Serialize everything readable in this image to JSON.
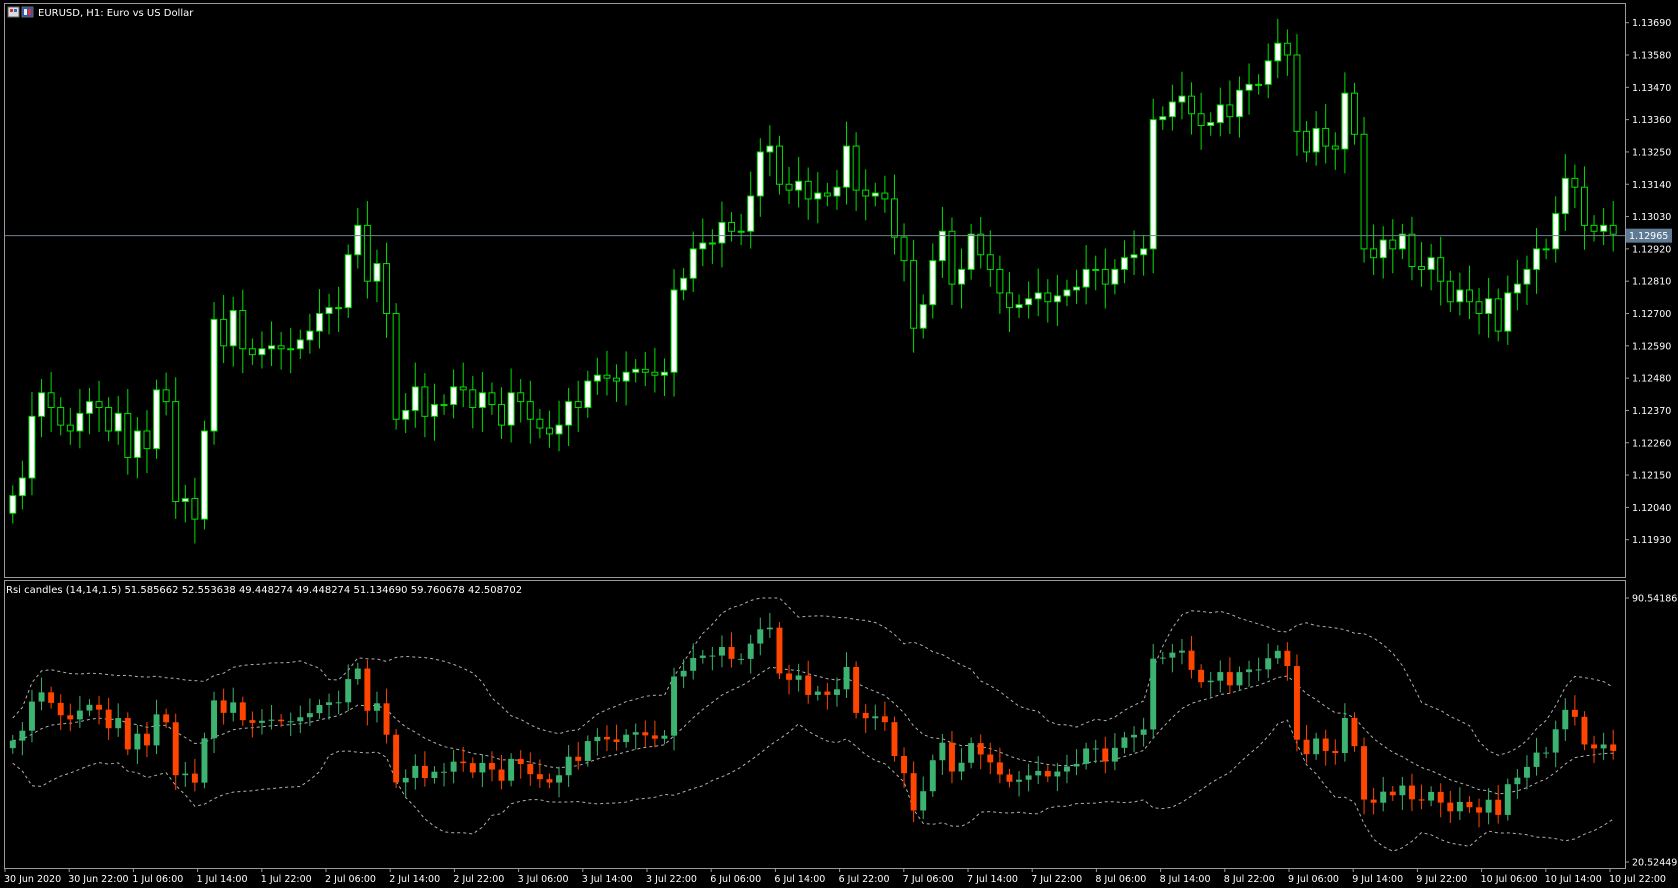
{
  "window": {
    "title": "EURUSD, H1:  Euro vs US Dollar"
  },
  "colors": {
    "background": "#000000",
    "bull_candle": "#ffffff",
    "bear_candle": "#000000",
    "candle_outline": "#00e000",
    "rsi_up": "#3cb371",
    "rsi_down": "#ff4500",
    "band": "#b0b0b0",
    "price_line": "#708090",
    "price_tag": "#5f7a94"
  },
  "chart_data": [
    {
      "type": "candlestick",
      "title": "EURUSD, H1:  Euro vs US Dollar",
      "ylim": [
        1.1182,
        1.1374
      ],
      "y_ticks": [
        "1.13690",
        "1.13580",
        "1.13470",
        "1.13360",
        "1.13250",
        "1.13140",
        "1.13030",
        "1.12920",
        "1.12810",
        "1.12700",
        "1.12590",
        "1.12480",
        "1.12370",
        "1.12260",
        "1.12150",
        "1.12040",
        "1.11930"
      ],
      "current_price": "1.12965",
      "closes": [
        1.1208,
        1.1214,
        1.1235,
        1.1243,
        1.1238,
        1.1232,
        1.123,
        1.1236,
        1.124,
        1.1238,
        1.123,
        1.1236,
        1.1221,
        1.123,
        1.1224,
        1.1244,
        1.124,
        1.1206,
        1.1207,
        1.12,
        1.123,
        1.1268,
        1.1259,
        1.1271,
        1.1258,
        1.1256,
        1.1258,
        1.1259,
        1.1258,
        1.1258,
        1.1261,
        1.1264,
        1.127,
        1.1272,
        1.1272,
        1.129,
        1.13,
        1.1281,
        1.1287,
        1.127,
        1.1234,
        1.1237,
        1.1245,
        1.1235,
        1.1239,
        1.1239,
        1.1245,
        1.1244,
        1.1238,
        1.1243,
        1.1239,
        1.1232,
        1.1243,
        1.124,
        1.1234,
        1.1231,
        1.1229,
        1.1232,
        1.124,
        1.1238,
        1.1247,
        1.1249,
        1.1248,
        1.1247,
        1.125,
        1.1251,
        1.125,
        1.1249,
        1.125,
        1.1278,
        1.1282,
        1.1292,
        1.1294,
        1.1294,
        1.1301,
        1.1298,
        1.1298,
        1.131,
        1.1325,
        1.1327,
        1.1314,
        1.1312,
        1.1315,
        1.1309,
        1.1311,
        1.131,
        1.1313,
        1.1327,
        1.1312,
        1.131,
        1.1311,
        1.1309,
        1.1296,
        1.1288,
        1.1265,
        1.1273,
        1.1288,
        1.1298,
        1.128,
        1.1285,
        1.1297,
        1.129,
        1.1285,
        1.1277,
        1.1272,
        1.1273,
        1.1275,
        1.1277,
        1.1274,
        1.1276,
        1.1278,
        1.1279,
        1.1285,
        1.1285,
        1.128,
        1.1285,
        1.1289,
        1.129,
        1.1292,
        1.1336,
        1.1337,
        1.1342,
        1.1344,
        1.1338,
        1.1334,
        1.1335,
        1.1341,
        1.1337,
        1.1346,
        1.1348,
        1.1348,
        1.1356,
        1.1362,
        1.1358,
        1.1332,
        1.1325,
        1.1333,
        1.1327,
        1.1326,
        1.1345,
        1.1331,
        1.1292,
        1.1289,
        1.1295,
        1.1292,
        1.1297,
        1.1286,
        1.1285,
        1.1289,
        1.1281,
        1.1274,
        1.1278,
        1.1274,
        1.127,
        1.1275,
        1.1264,
        1.1277,
        1.128,
        1.1285,
        1.1292,
        1.1292,
        1.1304,
        1.1316,
        1.1313,
        1.13,
        1.1298,
        1.13,
        1.1297
      ]
    },
    {
      "type": "candlestick",
      "title": "Rsi candles (14,14,1.5) 51.585662 52.553638 49.448274 49.448274 51.134690 59.760678 42.508702",
      "ylim": [
        20.524498,
        90.54186
      ],
      "y_ticks": [
        "90.541860",
        "20.524498"
      ],
      "x_ticks": [
        "30 Jun 2020",
        "30 Jun 22:00",
        "1 Jul 06:00",
        "1 Jul 14:00",
        "1 Jul 22:00",
        "2 Jul 06:00",
        "2 Jul 14:00",
        "2 Jul 22:00",
        "3 Jul 06:00",
        "3 Jul 14:00",
        "3 Jul 22:00",
        "6 Jul 06:00",
        "6 Jul 14:00",
        "6 Jul 22:00",
        "7 Jul 06:00",
        "7 Jul 14:00",
        "7 Jul 22:00",
        "8 Jul 06:00",
        "8 Jul 14:00",
        "8 Jul 22:00",
        "9 Jul 06:00",
        "9 Jul 14:00",
        "9 Jul 22:00",
        "10 Jul 06:00",
        "10 Jul 14:00",
        "10 Jul 22:00"
      ]
    }
  ]
}
